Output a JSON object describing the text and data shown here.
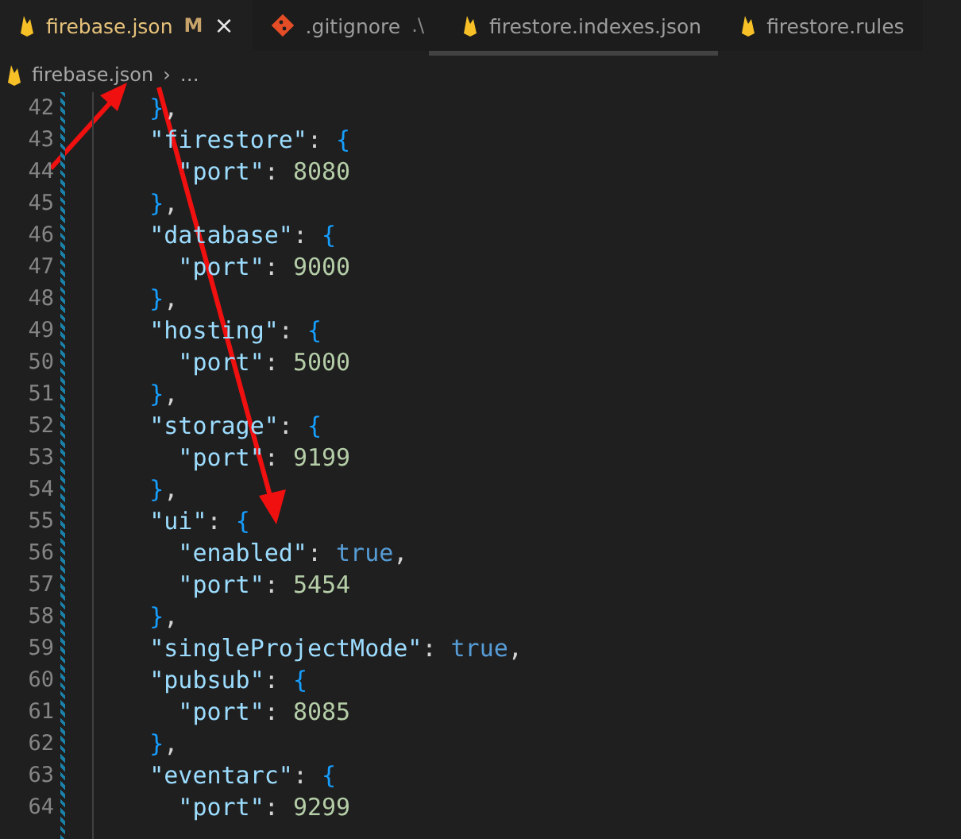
{
  "tabs": [
    {
      "label": "firebase.json",
      "kind": "firebase",
      "selected": true,
      "modified": "M",
      "close": "×"
    },
    {
      "label": ".gitignore",
      "kind": "git",
      "selected": false,
      "path": ".\\"
    },
    {
      "label": "firestore.indexes.json",
      "kind": "firebase",
      "selected": false
    },
    {
      "label": "firestore.rules",
      "kind": "firebase",
      "selected": false
    }
  ],
  "breadcrumb": {
    "file": "firebase.json",
    "separator": "›",
    "more": "…"
  },
  "lines": [
    {
      "number": "42",
      "tokens": [
        {
          "kind": "brace",
          "text": "    }"
        },
        {
          "kind": "punct",
          "text": ","
        }
      ]
    },
    {
      "number": "43",
      "tokens": [
        {
          "kind": "key",
          "text": "    \"firestore\""
        },
        {
          "kind": "punct",
          "text": ": "
        },
        {
          "kind": "brace",
          "text": "{"
        }
      ]
    },
    {
      "number": "44",
      "tokens": [
        {
          "kind": "key",
          "text": "      \"port\""
        },
        {
          "kind": "punct",
          "text": ": "
        },
        {
          "kind": "number",
          "text": "8080"
        }
      ]
    },
    {
      "number": "45",
      "tokens": [
        {
          "kind": "brace",
          "text": "    }"
        },
        {
          "kind": "punct",
          "text": ","
        }
      ]
    },
    {
      "number": "46",
      "tokens": [
        {
          "kind": "key",
          "text": "    \"database\""
        },
        {
          "kind": "punct",
          "text": ": "
        },
        {
          "kind": "brace",
          "text": "{"
        }
      ]
    },
    {
      "number": "47",
      "tokens": [
        {
          "kind": "key",
          "text": "      \"port\""
        },
        {
          "kind": "punct",
          "text": ": "
        },
        {
          "kind": "number",
          "text": "9000"
        }
      ]
    },
    {
      "number": "48",
      "tokens": [
        {
          "kind": "brace",
          "text": "    }"
        },
        {
          "kind": "punct",
          "text": ","
        }
      ]
    },
    {
      "number": "49",
      "tokens": [
        {
          "kind": "key",
          "text": "    \"hosting\""
        },
        {
          "kind": "punct",
          "text": ": "
        },
        {
          "kind": "brace",
          "text": "{"
        }
      ]
    },
    {
      "number": "50",
      "tokens": [
        {
          "kind": "key",
          "text": "      \"port\""
        },
        {
          "kind": "punct",
          "text": ": "
        },
        {
          "kind": "number",
          "text": "5000"
        }
      ]
    },
    {
      "number": "51",
      "tokens": [
        {
          "kind": "brace",
          "text": "    }"
        },
        {
          "kind": "punct",
          "text": ","
        }
      ]
    },
    {
      "number": "52",
      "tokens": [
        {
          "kind": "key",
          "text": "    \"storage\""
        },
        {
          "kind": "punct",
          "text": ": "
        },
        {
          "kind": "brace",
          "text": "{"
        }
      ]
    },
    {
      "number": "53",
      "tokens": [
        {
          "kind": "key",
          "text": "      \"port\""
        },
        {
          "kind": "punct",
          "text": ": "
        },
        {
          "kind": "number",
          "text": "9199"
        }
      ]
    },
    {
      "number": "54",
      "tokens": [
        {
          "kind": "brace",
          "text": "    }"
        },
        {
          "kind": "punct",
          "text": ","
        }
      ]
    },
    {
      "number": "55",
      "tokens": [
        {
          "kind": "key",
          "text": "    \"ui\""
        },
        {
          "kind": "punct",
          "text": ": "
        },
        {
          "kind": "brace",
          "text": "{"
        }
      ]
    },
    {
      "number": "56",
      "tokens": [
        {
          "kind": "key",
          "text": "      \"enabled\""
        },
        {
          "kind": "punct",
          "text": ": "
        },
        {
          "kind": "bool",
          "text": "true"
        },
        {
          "kind": "punct",
          "text": ","
        }
      ]
    },
    {
      "number": "57",
      "tokens": [
        {
          "kind": "key",
          "text": "      \"port\""
        },
        {
          "kind": "punct",
          "text": ": "
        },
        {
          "kind": "number",
          "text": "5454"
        }
      ]
    },
    {
      "number": "58",
      "tokens": [
        {
          "kind": "brace",
          "text": "    }"
        },
        {
          "kind": "punct",
          "text": ","
        }
      ]
    },
    {
      "number": "59",
      "tokens": [
        {
          "kind": "key",
          "text": "    \"singleProjectMode\""
        },
        {
          "kind": "punct",
          "text": ": "
        },
        {
          "kind": "bool",
          "text": "true"
        },
        {
          "kind": "punct",
          "text": ","
        }
      ]
    },
    {
      "number": "60",
      "tokens": [
        {
          "kind": "key",
          "text": "    \"pubsub\""
        },
        {
          "kind": "punct",
          "text": ": "
        },
        {
          "kind": "brace",
          "text": "{"
        }
      ]
    },
    {
      "number": "61",
      "tokens": [
        {
          "kind": "key",
          "text": "      \"port\""
        },
        {
          "kind": "punct",
          "text": ": "
        },
        {
          "kind": "number",
          "text": "8085"
        }
      ]
    },
    {
      "number": "62",
      "tokens": [
        {
          "kind": "brace",
          "text": "    }"
        },
        {
          "kind": "punct",
          "text": ","
        }
      ]
    },
    {
      "number": "63",
      "tokens": [
        {
          "kind": "key",
          "text": "    \"eventarc\""
        },
        {
          "kind": "punct",
          "text": ": "
        },
        {
          "kind": "brace",
          "text": "{"
        }
      ]
    },
    {
      "number": "64",
      "tokens": [
        {
          "kind": "key",
          "text": "      \"port\""
        },
        {
          "kind": "punct",
          "text": ": "
        },
        {
          "kind": "number",
          "text": "9299"
        }
      ]
    }
  ]
}
